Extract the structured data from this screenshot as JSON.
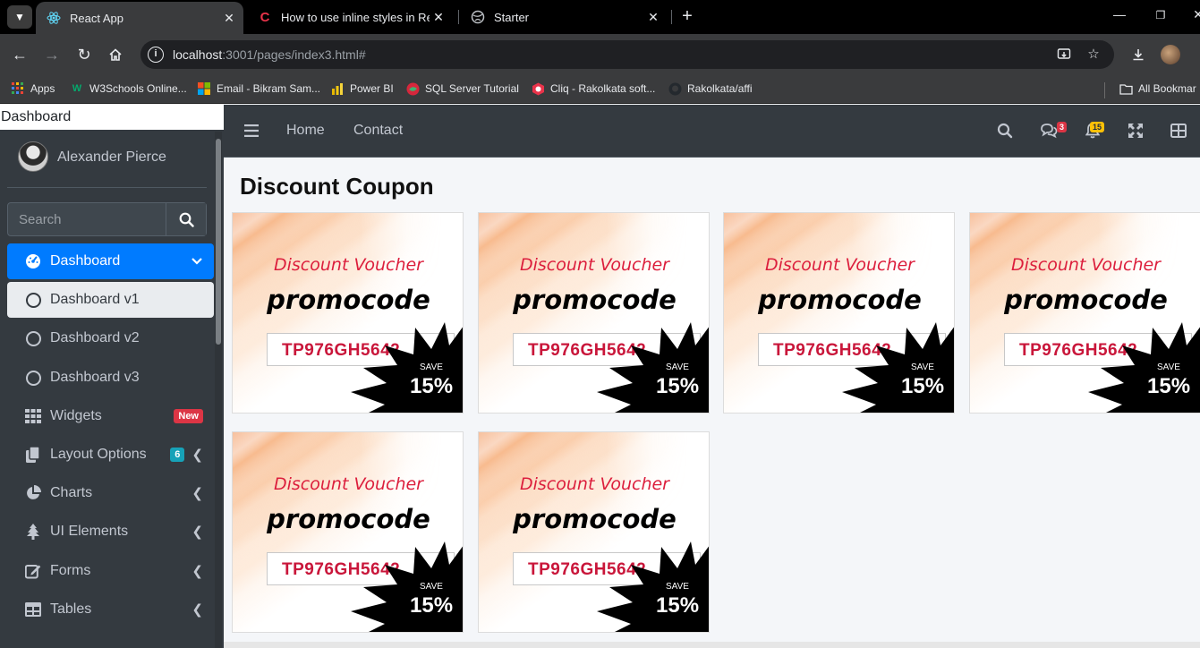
{
  "browser": {
    "tabs": [
      {
        "title": "React App",
        "active": true,
        "favicon": "react-icon"
      },
      {
        "title": "How to use inline styles in Reac",
        "active": false,
        "favicon": "codecademy-c-icon"
      },
      {
        "title": "Starter",
        "active": false,
        "favicon": "globe-icon"
      }
    ],
    "url_host": "localhost",
    "url_rest": ":3001/pages/index3.html#",
    "bookmarks": [
      {
        "label": "Apps",
        "icon": "apps-grid-icon"
      },
      {
        "label": "W3Schools Online...",
        "icon": "w3schools-icon"
      },
      {
        "label": "Email - Bikram Sam...",
        "icon": "microsoft-icon"
      },
      {
        "label": "Power BI",
        "icon": "powerbi-icon"
      },
      {
        "label": "SQL Server Tutorial",
        "icon": "sql-icon"
      },
      {
        "label": "Cliq - Rakolkata soft...",
        "icon": "cliq-icon"
      },
      {
        "label": "Rakolkata/affi",
        "icon": "github-icon"
      }
    ],
    "all_bookmarks": "All Bookmar"
  },
  "sidebar": {
    "brand": "Dashboard",
    "user_name": "Alexander Pierce",
    "search_placeholder": "Search",
    "items": [
      {
        "label": "Dashboard",
        "icon": "tachometer-icon",
        "state": "active",
        "right": "chevron-down"
      },
      {
        "label": "Dashboard v1",
        "icon": "circle-icon",
        "state": "sub-active"
      },
      {
        "label": "Dashboard v2",
        "icon": "circle-icon",
        "state": ""
      },
      {
        "label": "Dashboard v3",
        "icon": "circle-icon",
        "state": ""
      },
      {
        "label": "Widgets",
        "icon": "th-icon",
        "state": "",
        "badge": "New"
      },
      {
        "label": "Layout Options",
        "icon": "copy-icon",
        "state": "",
        "badge": "6"
      },
      {
        "label": "Charts",
        "icon": "pie-chart-icon",
        "state": ""
      },
      {
        "label": "UI Elements",
        "icon": "tree-icon",
        "state": ""
      },
      {
        "label": "Forms",
        "icon": "edit-icon",
        "state": ""
      },
      {
        "label": "Tables",
        "icon": "table-icon",
        "state": ""
      }
    ]
  },
  "topnav": {
    "home": "Home",
    "contact": "Contact",
    "messages_count": "3",
    "notifications_count": "15"
  },
  "content": {
    "title": "Discount Coupon",
    "coupons": [
      {
        "heading": "Discount Voucher",
        "word": "promocode",
        "code": "TP976GH5642",
        "save_label": "SAVE",
        "percent": "15%"
      },
      {
        "heading": "Discount Voucher",
        "word": "promocode",
        "code": "TP976GH5642",
        "save_label": "SAVE",
        "percent": "15%"
      },
      {
        "heading": "Discount Voucher",
        "word": "promocode",
        "code": "TP976GH5642",
        "save_label": "SAVE",
        "percent": "15%"
      },
      {
        "heading": "Discount Voucher",
        "word": "promocode",
        "code": "TP976GH5642",
        "save_label": "SAVE",
        "percent": "15%"
      },
      {
        "heading": "Discount Voucher",
        "word": "promocode",
        "code": "TP976GH5642",
        "save_label": "SAVE",
        "percent": "15%"
      },
      {
        "heading": "Discount Voucher",
        "word": "promocode",
        "code": "TP976GH5642",
        "save_label": "SAVE",
        "percent": "15%"
      }
    ]
  },
  "colors": {
    "sidebar_bg": "#343a40",
    "active_blue": "#007bff",
    "voucher_red": "#dc1e3c",
    "code_red": "#c9163a",
    "badge_red": "#dc3545",
    "badge_teal": "#17a2b8",
    "badge_yellow": "#ffc107"
  }
}
